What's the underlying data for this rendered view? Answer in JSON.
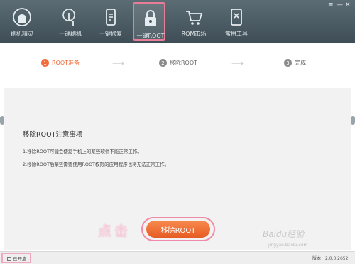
{
  "window_controls": {
    "menu": "≡",
    "minimize": "—",
    "close": "✕"
  },
  "toolbar": {
    "items": [
      {
        "label": "刷机精灵",
        "icon": "android-icon"
      },
      {
        "label": "一键刷机",
        "icon": "hand-touch-icon"
      },
      {
        "label": "一键修复",
        "icon": "phone-repair-icon"
      },
      {
        "label": "一键ROOT",
        "icon": "lock-icon",
        "active": true
      },
      {
        "label": "ROM市场",
        "icon": "cart-icon"
      },
      {
        "label": "常用工具",
        "icon": "tools-icon"
      }
    ]
  },
  "steps": [
    {
      "num": "1",
      "label": "ROOT准备"
    },
    {
      "num": "2",
      "label": "移除ROOT"
    },
    {
      "num": "3",
      "label": "完成"
    }
  ],
  "notice": {
    "title": "移除ROOT注意事项",
    "line1": "1.移除ROOT可能会使您手机上的某些软件不能正常工作。",
    "line2": "2.移除ROOT后某些需要使用ROOT权限的应用程序也将无法正常工作。"
  },
  "annotation": "点击",
  "remove_button": "移除ROOT",
  "watermark": "Baidu经验",
  "watermark_sub": "jingyan.baidu.com",
  "status": {
    "checkbox_label": "已开启",
    "version": "版本：2.0.0.2652"
  },
  "colors": {
    "accent": "#f26b3a",
    "toolbar": "#4a5a62",
    "highlight": "#ef8aa8"
  }
}
